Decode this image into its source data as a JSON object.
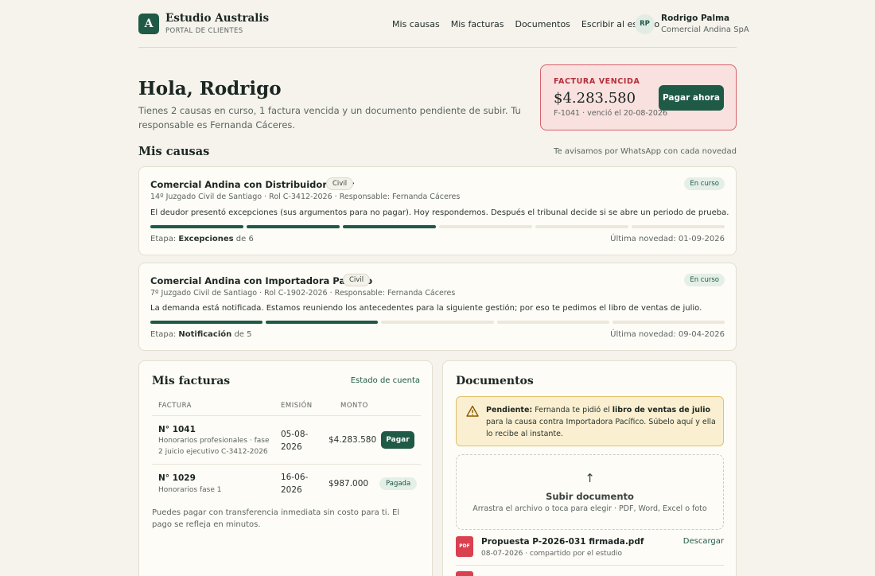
{
  "header": {
    "logo_letter": "A",
    "brand": "Estudio Australis",
    "subtitle": "PORTAL DE CLIENTES",
    "nav": [
      "Mis causas",
      "Mis facturas",
      "Documentos",
      "Escribir al estudio"
    ],
    "user": {
      "initials": "RP",
      "name": "Rodrigo Palma",
      "company": "Comercial Andina SpA"
    }
  },
  "greeting": {
    "title": "Hola, Rodrigo",
    "summary": "Tienes 2 causas en curso, 1 factura vencida y un documento pendiente de subir. Tu responsable es Fernanda Cáceres."
  },
  "overdue": {
    "label": "FACTURA VENCIDA",
    "amount": "$4.283.580",
    "meta": "F-1041 · venció el 20-08-2026",
    "button": "Pagar ahora"
  },
  "cases_section": {
    "title": "Mis causas",
    "note": "Te avisamos por WhatsApp con cada novedad",
    "cases": [
      {
        "title": "Comercial Andina con Distribuidora Sur",
        "type": "Civil",
        "status": "En curso",
        "court": "14º Juzgado Civil de Santiago · Rol C-3412-2026 · Responsable: Fernanda Cáceres",
        "description": "El deudor presentó excepciones (sus argumentos para no pagar). Hoy respondemos. Después el tribunal decide si se abre un periodo de prueba.",
        "stage_prefix": "Etapa: ",
        "stage": "Excepciones",
        "stage_suffix": " de 6",
        "stage_done": 3,
        "stage_total": 6,
        "update": "Última novedad: 01-09-2026"
      },
      {
        "title": "Comercial Andina con Importadora Pacífico",
        "type": "Civil",
        "status": "En curso",
        "court": "7º Juzgado Civil de Santiago · Rol C-1902-2026 · Responsable: Fernanda Cáceres",
        "description": "La demanda está notificada. Estamos reuniendo los antecedentes para la siguiente gestión; por eso te pedimos el libro de ventas de julio.",
        "stage_prefix": "Etapa: ",
        "stage": "Notificación",
        "stage_suffix": " de 5",
        "stage_done": 2,
        "stage_total": 5,
        "update": "Última novedad: 09-04-2026"
      }
    ]
  },
  "invoices": {
    "title": "Mis facturas",
    "link": "Estado de cuenta",
    "columns": [
      "FACTURA",
      "EMISIÓN",
      "MONTO"
    ],
    "rows": [
      {
        "number": "N° 1041",
        "description": "Honorarios profesionales · fase 2 juicio ejecutivo C-3412-2026",
        "date": "05-08-2026",
        "amount": "$4.283.580",
        "action": "Pagar"
      },
      {
        "number": "N° 1029",
        "description": "Honorarios fase 1",
        "date": "16-06-2026",
        "amount": "$987.000",
        "status": "Pagada"
      }
    ],
    "note": "Puedes pagar con transferencia inmediata sin costo para ti. El pago se refleja en minutos."
  },
  "documents": {
    "title": "Documentos",
    "alert": {
      "strong": "Pendiente:",
      "text1": " Fernanda te pidió el ",
      "bold": "libro de ventas de julio",
      "text2": " para la causa contra Importadora Pacífico. Súbelo aquí y ella lo recibe al instante."
    },
    "upload": {
      "arrow": "↑",
      "title": "Subir documento",
      "subtitle": "Arrastra el archivo o toca para elegir · PDF, Word, Excel o foto"
    },
    "files": [
      {
        "icon": "PDF",
        "name": "Propuesta P-2026-031 firmada.pdf",
        "meta": "08-07-2026 · compartido por el estudio",
        "action": "Descargar"
      }
    ]
  },
  "colors": {
    "accent": "#1f5a46",
    "danger": "#b3303b",
    "background": "#f5f3ec",
    "warning_bg": "#faefd0"
  }
}
